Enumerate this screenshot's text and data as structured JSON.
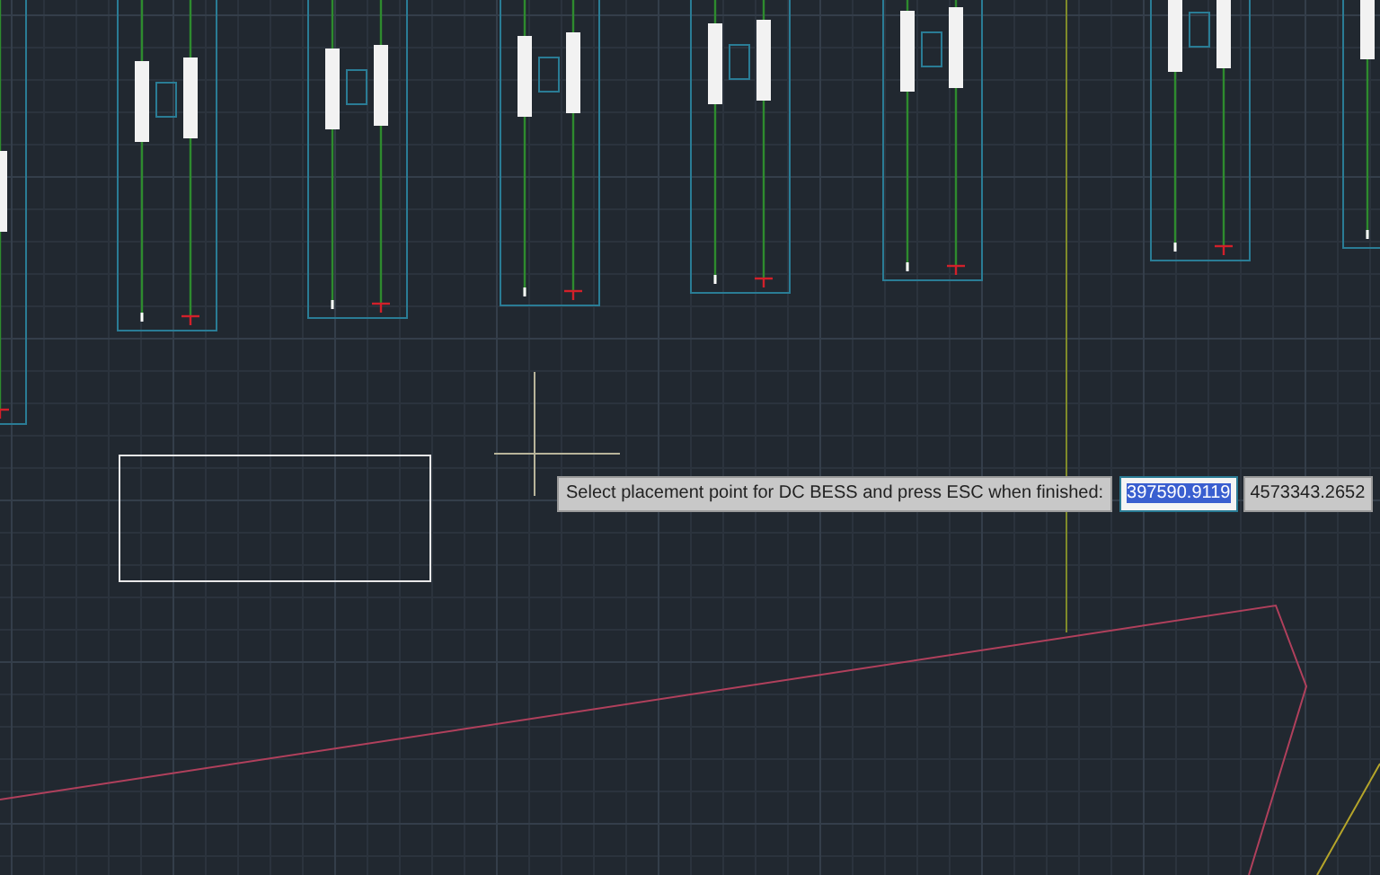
{
  "command_prompt": {
    "text": "Select placement point for DC BESS and press ESC when finished:"
  },
  "coordinate_fields": [
    {
      "value": "397590.9119",
      "selected": true
    },
    {
      "value": "4573343.2652",
      "selected": false
    }
  ]
}
